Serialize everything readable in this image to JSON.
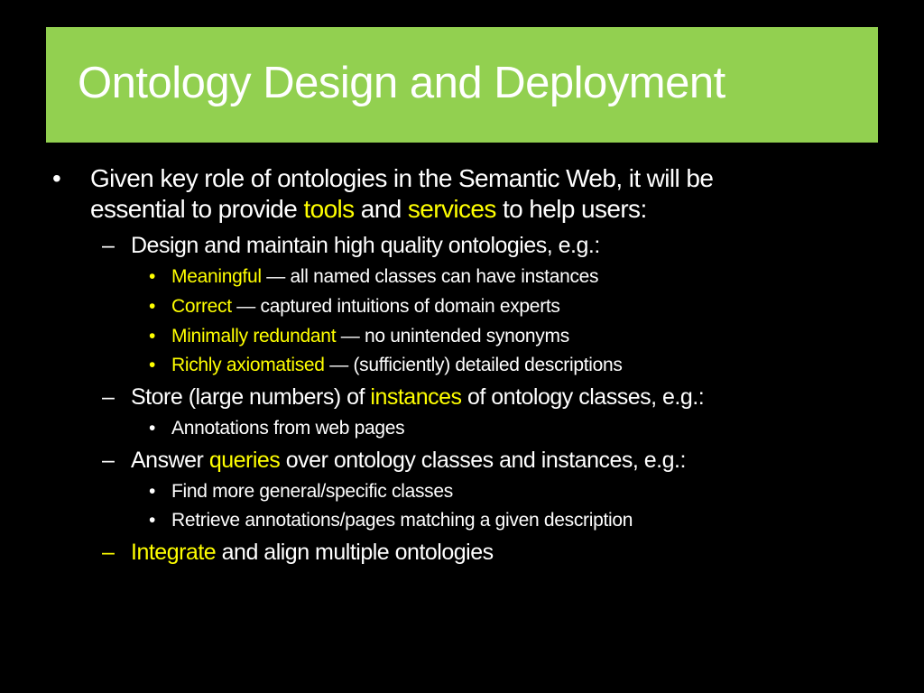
{
  "slide": {
    "title": "Ontology Design and Deployment",
    "colors": {
      "title_bg": "#92d050",
      "highlight": "#ffff00",
      "text": "#ffffff",
      "background": "#000000"
    },
    "bullet": {
      "marker": "•",
      "line1": "Given key role of ontologies in the Semantic Web, it will be",
      "line2_pre": "essential to provide ",
      "line2_hl1": "tools",
      "line2_mid": " and ",
      "line2_hl2": "services",
      "line2_post": " to help users:"
    },
    "sub_items": [
      {
        "marker": "–",
        "pre": "Design and maintain high quality ontologies, e.g.:",
        "children": [
          {
            "marker": "•",
            "hl": "Meaningful",
            "text": " — all named classes can have instances"
          },
          {
            "marker": "•",
            "hl": "Correct",
            "text": " — captured intuitions of domain experts"
          },
          {
            "marker": "•",
            "hl": "Minimally redundant",
            "text": " — no unintended synonyms"
          },
          {
            "marker": "•",
            "hl": "Richly axiomatised",
            "text": " — (sufficiently) detailed descriptions"
          }
        ]
      },
      {
        "marker": "–",
        "pre": "Store (large numbers) of ",
        "hl": "instances",
        "post": " of ontology classes, e.g.:",
        "children": [
          {
            "marker": "•",
            "text": "Annotations from web pages"
          }
        ]
      },
      {
        "marker": "–",
        "pre": "Answer ",
        "hl": "queries",
        "post": " over ontology classes and instances, e.g.:",
        "children": [
          {
            "marker": "•",
            "text": "Find more general/specific classes"
          },
          {
            "marker": "•",
            "text": "Retrieve annotations/pages matching a given description"
          }
        ]
      },
      {
        "marker": "–",
        "hl": "Integrate",
        "post": " and align multiple ontologies"
      }
    ]
  }
}
